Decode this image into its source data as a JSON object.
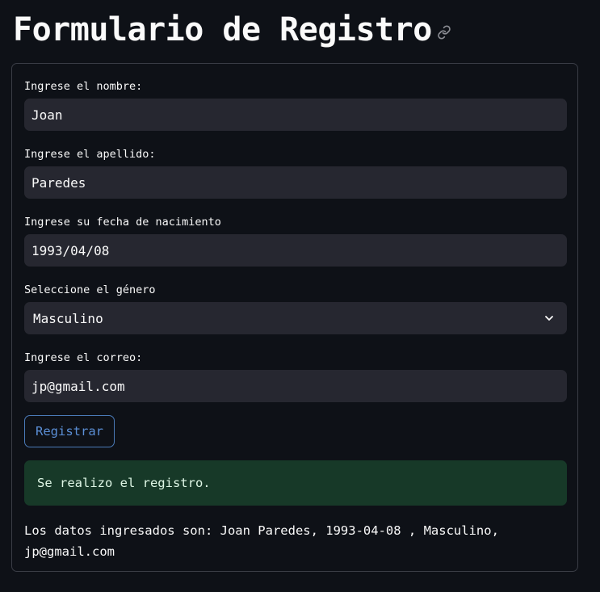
{
  "page": {
    "title": "Formulario de Registro",
    "link_icon": "link-icon"
  },
  "form": {
    "nombre": {
      "label": "Ingrese el nombre:",
      "value": "Joan"
    },
    "apellido": {
      "label": "Ingrese el apellido:",
      "value": "Paredes"
    },
    "fecha": {
      "label": "Ingrese su fecha de nacimiento",
      "value": "1993/04/08"
    },
    "genero": {
      "label": "Seleccione el género",
      "value": "Masculino",
      "icon": "chevron-down-icon"
    },
    "correo": {
      "label": "Ingrese el correo:",
      "value": "jp@gmail.com"
    },
    "submit_label": "Registrar"
  },
  "alert": {
    "message": "Se realizo el registro.",
    "color": "#173928"
  },
  "result": {
    "text": "Los datos ingresados son: Joan Paredes, 1993-04-08 , Masculino, jp@gmail.com"
  },
  "colors": {
    "background": "#0e1117",
    "input_background": "#262730",
    "button_accent": "#5b8fd6"
  }
}
